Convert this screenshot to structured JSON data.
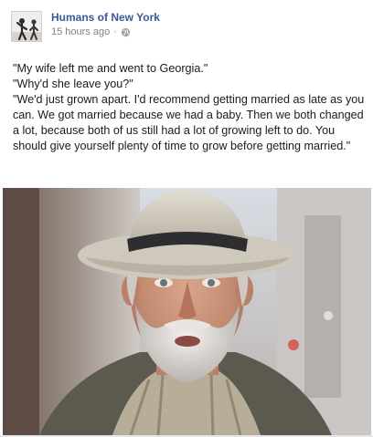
{
  "post": {
    "page_name": "Humans of New York",
    "timestamp": "15 hours ago",
    "privacy_icon": "globe-icon",
    "avatar_icon": "profile-photo",
    "lines": [
      "\"My wife left me and went to Georgia.\"",
      "\"Why'd she leave you?\"",
      "\"We'd just grown apart. I'd recommend getting married as late as you can. We got married because we had a baby. Then we both changed a lot, because both of us still had a lot of growing left to do. You should give yourself plenty of time to grow before getting married.\""
    ],
    "photo": "portrait-photo",
    "colors": {
      "link": "#3b5998",
      "meta": "#808080",
      "text": "#1a1a1a"
    }
  }
}
